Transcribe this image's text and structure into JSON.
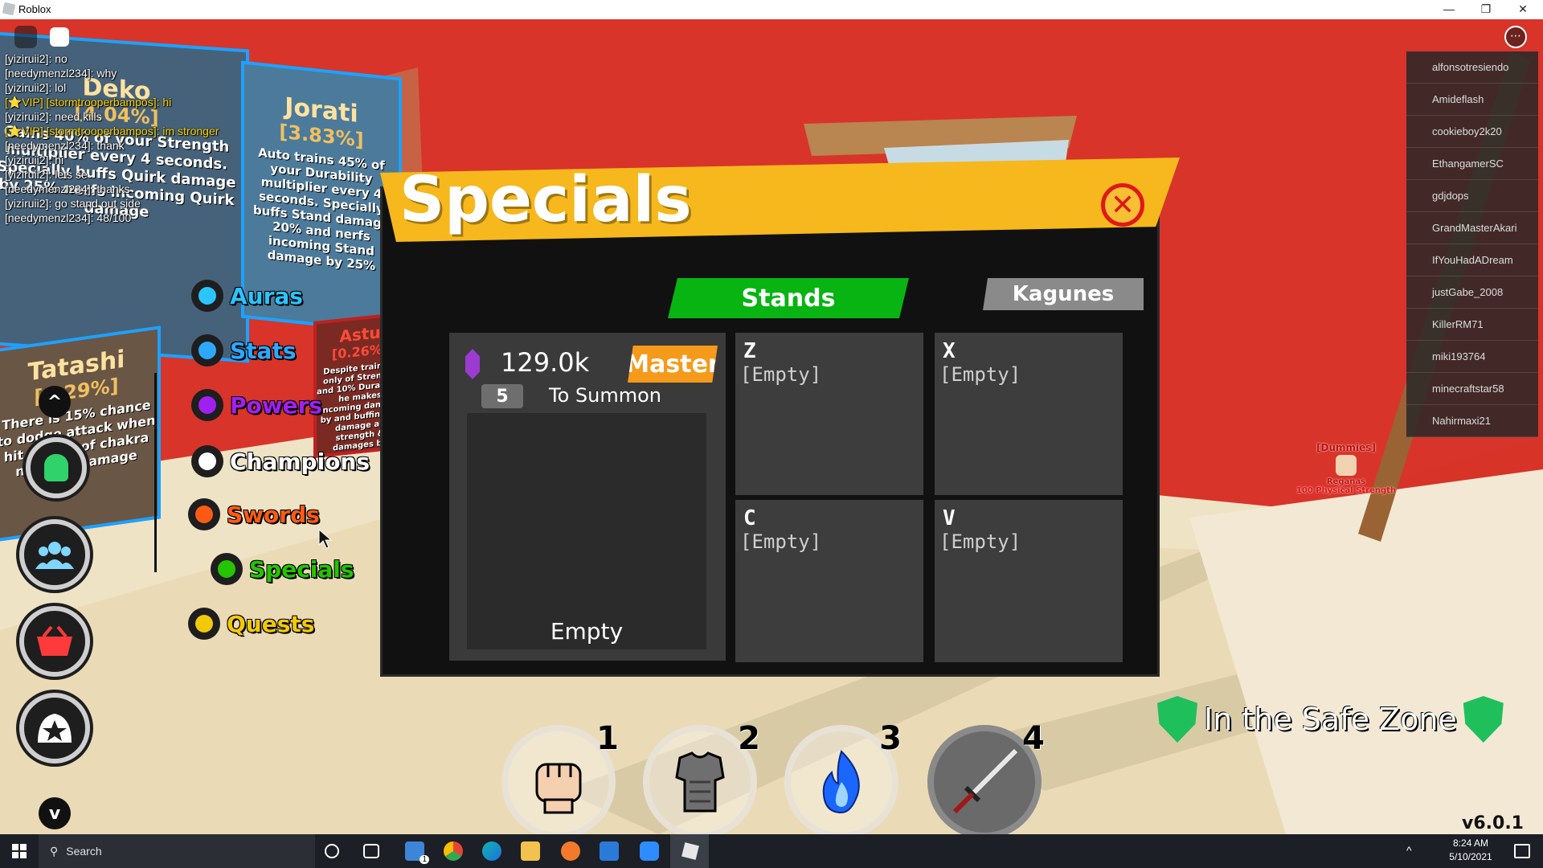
{
  "window": {
    "title": "Roblox",
    "minimize": "—",
    "maximize": "❐",
    "close": "✕"
  },
  "chat": [
    {
      "text": "[yiziruii2]: no",
      "vip": false
    },
    {
      "text": "[needymenzl234]: why",
      "vip": false
    },
    {
      "text": "[yiziruii2]: lol",
      "vip": false
    },
    {
      "text": "[⭐VIP] [stormtrooperbampos]: hi",
      "vip": true
    },
    {
      "text": "[yiziruii2]: need kills",
      "vip": false
    },
    {
      "text": "[⭐VIP] [stormtrooperbampos]: im stronger",
      "vip": true
    },
    {
      "text": "[needymenzl234]: thank",
      "vip": false
    },
    {
      "text": "[yiziruii2]: hi",
      "vip": false
    },
    {
      "text": "[yiziruii2]: lets se",
      "vip": false
    },
    {
      "text": "[needymenzl234]: thanks",
      "vip": false
    },
    {
      "text": "[yiziruii2]: go stand out side",
      "vip": false
    },
    {
      "text": "[needymenzl234]: 48/100",
      "vip": false
    }
  ],
  "boards": [
    {
      "name": "Deko",
      "pct": "[4.04%]",
      "desc": "Gains 40% of your Strength multiplier every 4 seconds. Specially buffs Quirk damage by 25% nerfs incoming Quirk damage"
    },
    {
      "name": "Jorati",
      "pct": "[3.83%]",
      "desc": "Auto trains 45% of your Durability multiplier every 4 seconds. Specially buffs Stand damage 20% and nerfs incoming Stand damage by 25%"
    },
    {
      "name": "Tatashi",
      "pct": "[0.29%]",
      "desc": "There is 15% chance to dodge attack when hit. Trains of chakra nerfs all damage"
    },
    {
      "name": "Astu",
      "pct": "[0.26%]",
      "desc": "Despite training only of Strength and 10% Durability he makes incoming damage by and buffing all damage all strength & damages by"
    }
  ],
  "menu": [
    {
      "label": "Auras",
      "color": "#2bc4ff"
    },
    {
      "label": "Stats",
      "color": "#2ea8ff"
    },
    {
      "label": "Powers",
      "color": "#a020f0"
    },
    {
      "label": "Champions",
      "color": "#ffffff"
    },
    {
      "label": "Swords",
      "color": "#ff5a14"
    },
    {
      "label": "Specials",
      "color": "#25c400"
    },
    {
      "label": "Quests",
      "color": "#f2c90a"
    }
  ],
  "left_buttons": {
    "up": "^",
    "down": "v"
  },
  "players": [
    "alfonsotresiendo",
    "Amideflash",
    "cookieboy2k20",
    "EthangamerSC",
    "gdjdops",
    "GrandMasterAkari",
    "IfYouHadADream",
    "justGabe_2008",
    "KillerRM71",
    "miki193764",
    "minecraftstar58",
    "Nahirmaxi21"
  ],
  "specials": {
    "title": "Specials",
    "close": "✕",
    "tabs": {
      "active": "Stands",
      "other": "Kagunes"
    },
    "currency": "129.0k",
    "rank": "Master",
    "cost": "5",
    "cost_label": "To Summon",
    "preview_label": "Empty",
    "slots": [
      {
        "key": "Z",
        "value": "[Empty]"
      },
      {
        "key": "X",
        "value": "[Empty]"
      },
      {
        "key": "C",
        "value": "[Empty]"
      },
      {
        "key": "V",
        "value": "[Empty]"
      }
    ]
  },
  "npc": {
    "tag": "[Dummies]",
    "name": "Reganas",
    "sub": "100 Physical Strength"
  },
  "hotbar": [
    {
      "num": "1",
      "icon": "fist-icon"
    },
    {
      "num": "2",
      "icon": "armor-icon"
    },
    {
      "num": "3",
      "icon": "flame-icon"
    },
    {
      "num": "4",
      "icon": "sword-icon"
    }
  ],
  "safezone": "In the Safe Zone",
  "version": "v6.0.1",
  "taskbar": {
    "search": "Search",
    "time": "8:24 AM",
    "date": "5/10/2021",
    "mail_badge": "1"
  }
}
